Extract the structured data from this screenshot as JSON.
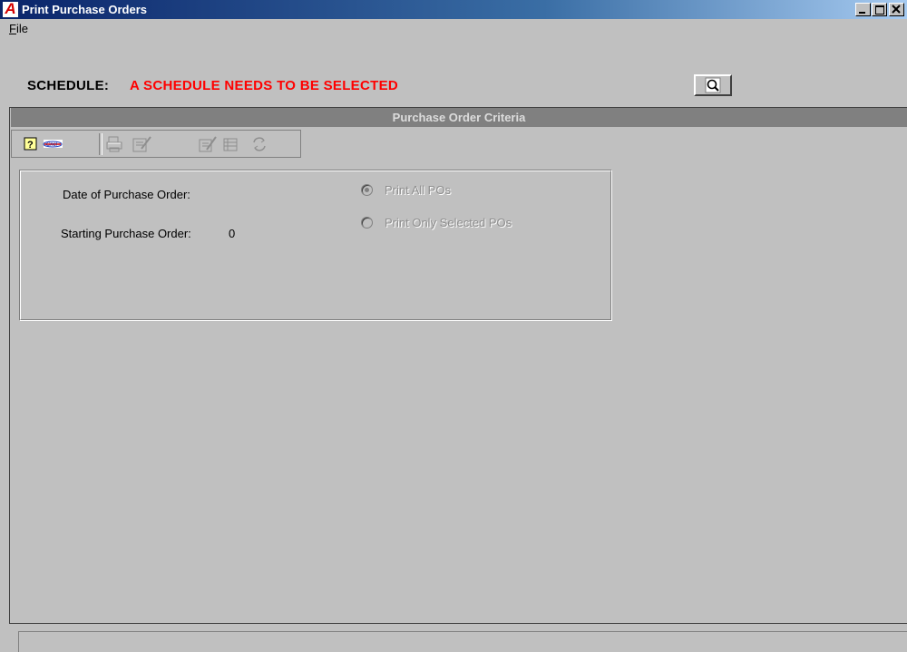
{
  "window": {
    "title": "Print Purchase Orders",
    "logo_letter": "A",
    "controls": [
      "minimize",
      "maximize",
      "close"
    ]
  },
  "menu": {
    "file_label": "File"
  },
  "schedule": {
    "label": "SCHEDULE:",
    "value": "A SCHEDULE NEEDS TO BE SELECTED",
    "value_color": "#ff0000",
    "lookup_icon": "magnifier-icon"
  },
  "criteria_panel": {
    "title": "Purchase Order Criteria"
  },
  "toolbar": {
    "buttons": [
      {
        "icon": "help-icon",
        "enabled": true
      },
      {
        "icon": "cancel-logo-icon",
        "enabled": true
      },
      {
        "icon": "print-icon",
        "enabled": false
      },
      {
        "icon": "print-preview-icon",
        "enabled": false
      },
      {
        "icon": "edit-icon",
        "enabled": false
      },
      {
        "icon": "delete-icon",
        "enabled": false
      },
      {
        "icon": "refresh-icon",
        "enabled": false
      }
    ]
  },
  "form": {
    "date_label": "Date of Purchase Order:",
    "date_value": "",
    "starting_po_label": "Starting Purchase Order:",
    "starting_po_value": "0",
    "print_options": [
      {
        "label": "Print All POs",
        "checked": true,
        "enabled": false
      },
      {
        "label": "Print Only Selected POs",
        "checked": false,
        "enabled": false
      }
    ]
  },
  "status_bar": {
    "text": ""
  }
}
